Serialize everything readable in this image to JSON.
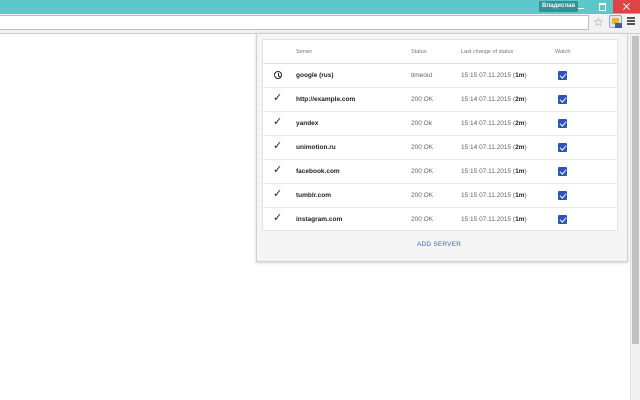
{
  "window": {
    "profile_name": "Владислав"
  },
  "toolbar": {
    "star_icon": "star-icon",
    "extension_icon": "extension-icon",
    "menu_icon": "menu-icon"
  },
  "popup": {
    "columns": {
      "server": "Server",
      "status": "Status",
      "last_change": "Last change of status",
      "watch": "Watch"
    },
    "rows": [
      {
        "icon": "clock-icon",
        "server": "google (rus)",
        "status": "timeout",
        "time": "15:15 07.11.2015 (",
        "duration": "1m",
        "close": ")",
        "watch": true
      },
      {
        "icon": "check-icon",
        "server": "http://example.com",
        "status": "200 OK",
        "time": "15:14 07.11.2015 (",
        "duration": "2m",
        "close": ")",
        "watch": true
      },
      {
        "icon": "check-icon",
        "server": "yandex",
        "status": "200 Ok",
        "time": "15:14 07.11.2015 (",
        "duration": "2m",
        "close": ")",
        "watch": true
      },
      {
        "icon": "check-icon",
        "server": "unimotion.ru",
        "status": "200 OK",
        "time": "15:14 07.11.2015 (",
        "duration": "2m",
        "close": ")",
        "watch": true
      },
      {
        "icon": "check-icon",
        "server": "facebook.com",
        "status": "200 OK",
        "time": "15:15 07.11.2015 (",
        "duration": "1m",
        "close": ")",
        "watch": true
      },
      {
        "icon": "check-icon",
        "server": "tumblr.com",
        "status": "200 OK",
        "time": "15:15 07.11.2015 (",
        "duration": "1m",
        "close": ")",
        "watch": true
      },
      {
        "icon": "check-icon",
        "server": "instagram.com",
        "status": "200 OK",
        "time": "15:15 07.11.2015 (",
        "duration": "1m",
        "close": ")",
        "watch": true
      }
    ],
    "add_server_label": "ADD SERVER"
  },
  "colors": {
    "titlebar": "#5cc8cb",
    "close_button": "#e04343",
    "checkbox": "#2d52b8",
    "link": "#3b63c6"
  }
}
